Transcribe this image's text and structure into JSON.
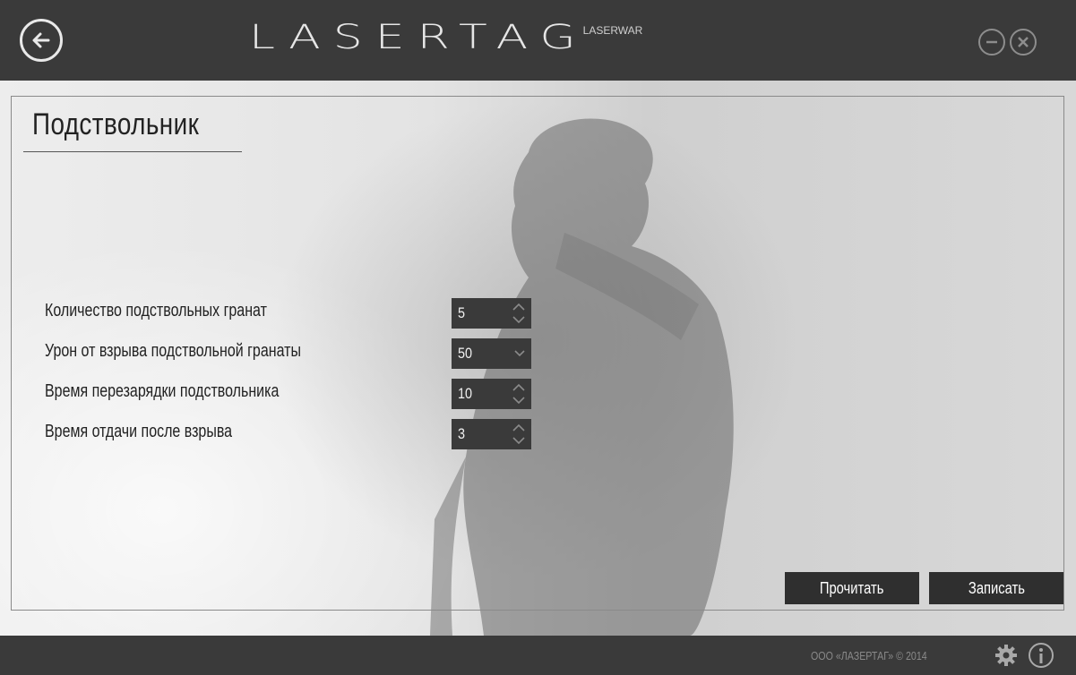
{
  "header": {
    "logo_text": "LASERTAG",
    "logo_sub": "LASERWAR",
    "icons": {
      "back": "back-arrow-icon",
      "minimize": "minimize-icon",
      "close": "close-icon"
    }
  },
  "page": {
    "title": "Подствольник"
  },
  "settings": [
    {
      "label": "Количество подствольных гранат",
      "value": "5",
      "control": "spinner"
    },
    {
      "label": "Урон от взрыва подствольной гранаты",
      "value": "50",
      "control": "dropdown"
    },
    {
      "label": "Время перезарядки подствольника",
      "value": "10",
      "control": "spinner"
    },
    {
      "label": "Время отдачи после взрыва",
      "value": "3",
      "control": "spinner"
    }
  ],
  "actions": {
    "read_label": "Прочитать",
    "write_label": "Записать"
  },
  "footer": {
    "copyright": "ООО «ЛАЗЕРТАГ» © 2014",
    "icons": {
      "settings": "gear-icon",
      "info": "info-icon"
    }
  },
  "colors": {
    "chrome": "#3a3a3a",
    "field_bg": "#3a3a3a",
    "button_bg": "#2f2f2f",
    "text": "#222222"
  }
}
